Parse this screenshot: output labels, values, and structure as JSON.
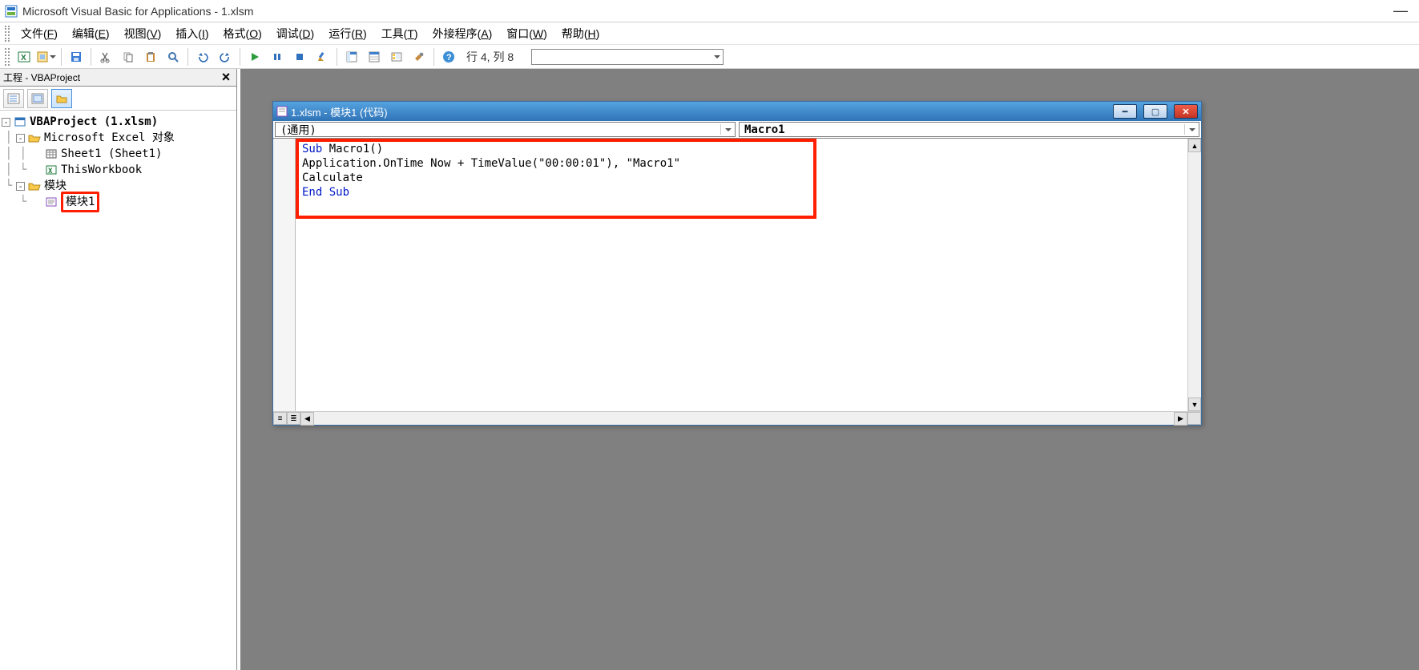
{
  "app": {
    "title": "Microsoft Visual Basic for Applications - 1.xlsm"
  },
  "menu": {
    "items": [
      {
        "label": "文件(F)",
        "ul": "F"
      },
      {
        "label": "编辑(E)",
        "ul": "E"
      },
      {
        "label": "视图(V)",
        "ul": "V"
      },
      {
        "label": "插入(I)",
        "ul": "I"
      },
      {
        "label": "格式(O)",
        "ul": "O"
      },
      {
        "label": "调试(D)",
        "ul": "D"
      },
      {
        "label": "运行(R)",
        "ul": "R"
      },
      {
        "label": "工具(T)",
        "ul": "T"
      },
      {
        "label": "外接程序(A)",
        "ul": "A"
      },
      {
        "label": "窗口(W)",
        "ul": "W"
      },
      {
        "label": "帮助(H)",
        "ul": "H"
      }
    ]
  },
  "toolbar": {
    "status": "行 4, 列 8"
  },
  "project_panel": {
    "title": "工程 - VBAProject",
    "tree": {
      "root_label": "VBAProject (1.xlsm)",
      "excel_objects_folder": "Microsoft Excel 对象",
      "sheet1_label": "Sheet1 (Sheet1)",
      "thisworkbook_label": "ThisWorkbook",
      "modules_folder": "模块",
      "module1_label": "模块1"
    }
  },
  "code_window": {
    "title": "1.xlsm - 模块1 (代码)",
    "object_dd": "(通用)",
    "proc_dd": "Macro1",
    "code": {
      "line1_kw": "Sub ",
      "line1_rest": "Macro1()",
      "line2": "Application.OnTime Now + TimeValue(\"00:00:01\"), \"Macro1\"",
      "line3": "Calculate",
      "line4_kw": "End Sub"
    }
  }
}
